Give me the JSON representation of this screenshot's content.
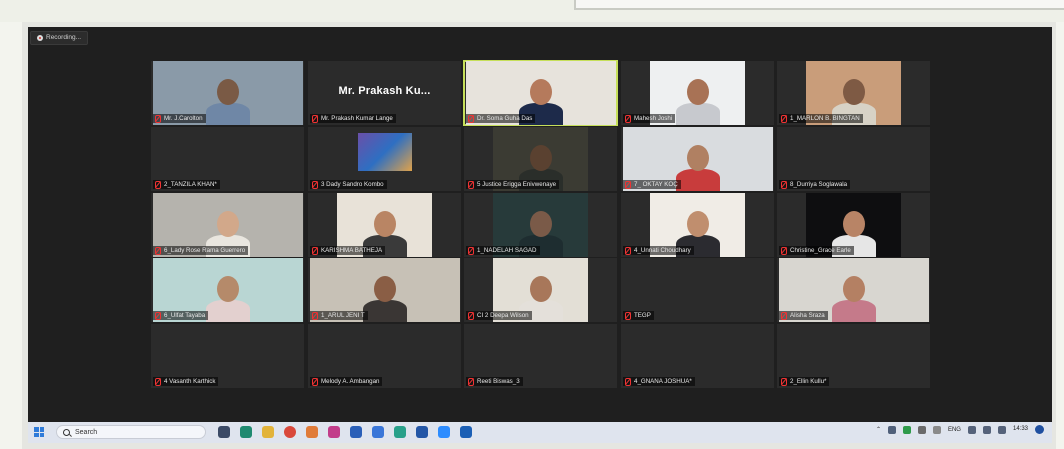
{
  "recording_label": "Recording...",
  "featured_name": "Mr. Prakash Ku...",
  "participants": [
    {
      "name": "Mr. J.Carolton",
      "video": true,
      "bg": "#8a9aa8",
      "skin": "#7a5a45",
      "shirt": "#6f87a6"
    },
    {
      "name": "Mr. Prakash Kumar Lange",
      "video": false
    },
    {
      "name": "Dr. Soma Guha Das",
      "video": true,
      "bg": "#e7e3dc",
      "skin": "#b57a5c",
      "shirt": "#1d2a4a"
    },
    {
      "name": "Mahesh Joshi",
      "video": true,
      "bg": "#eef0f1",
      "skin": "#a87255",
      "shirt": "#c7c9ce"
    },
    {
      "name": "1_MARLON B. BINGTAN",
      "video": true,
      "bg": "#c99d7a",
      "skin": "#7e5a44",
      "shirt": "#d7d2c6"
    },
    {
      "name": "2_TANZILA KHAN*",
      "video": false
    },
    {
      "name": "3 Dady Sandro Kombo",
      "video": false,
      "thumb": true
    },
    {
      "name": "5 Justice Erigga Enivwenaye",
      "video": true,
      "bg": "#3b3b33",
      "skin": "#5a4130",
      "shirt": "#2a2e2a"
    },
    {
      "name": "7_ OKTAY KOÇ",
      "video": true,
      "bg": "#d9dcdf",
      "skin": "#b08062",
      "shirt": "#c83c3c"
    },
    {
      "name": "8_Durriya Soglawala",
      "video": false
    },
    {
      "name": "6_Lady Rose Rama Guerrero",
      "video": true,
      "bg": "#b5b3ad",
      "skin": "#d2a88a",
      "shirt": "#e9e6df"
    },
    {
      "name": "KARISHMA BATHEJA",
      "video": true,
      "bg": "#e8e2d8",
      "skin": "#b98564",
      "shirt": "#3a3a3a"
    },
    {
      "name": "1_NADELAH SAGAD",
      "video": true,
      "bg": "#273a3a",
      "skin": "#7a5a48",
      "shirt": "#1e2d30"
    },
    {
      "name": "4_Unnati Choudhary",
      "video": true,
      "bg": "#f0ece6",
      "skin": "#c08e6e",
      "shirt": "#2b2b30"
    },
    {
      "name": "Christine_Grace Earle",
      "video": true,
      "bg": "#0e0e10",
      "skin": "#b88466",
      "shirt": "#e6e6e6"
    },
    {
      "name": "6_Ulfat Tayaba",
      "video": true,
      "bg": "#b9d6d3",
      "skin": "#b58a6a",
      "shirt": "#e3d0cf"
    },
    {
      "name": "1_ARUL JENI T",
      "video": true,
      "bg": "#c7c1b6",
      "skin": "#8a5e45",
      "shirt": "#3a3634"
    },
    {
      "name": "CI 2 Deepa Wilson",
      "video": true,
      "bg": "#e3dfd6",
      "skin": "#a8775a",
      "shirt": "#e4e0da"
    },
    {
      "name": "TEGP",
      "video": false
    },
    {
      "name": "Alisha Sraza",
      "video": true,
      "bg": "#d8d6d0",
      "skin": "#b48063",
      "shirt": "#c57a8a"
    },
    {
      "name": "4 Vasanth Karthick",
      "video": false
    },
    {
      "name": "Melody A. Ambangan",
      "video": false
    },
    {
      "name": "Reeti Biswas_3",
      "video": false
    },
    {
      "name": "4_GNANA JOSHUA*",
      "video": false
    },
    {
      "name": "2_Ellin Kullu*",
      "video": false
    }
  ],
  "taskbar": {
    "search_placeholder": "Search",
    "language": "ENG",
    "time": "14:33"
  },
  "colors": {
    "active_speaker": "#c6df5a",
    "meeting_bg": "#1f1f1f",
    "tile_bg": "#2b2b2b"
  }
}
